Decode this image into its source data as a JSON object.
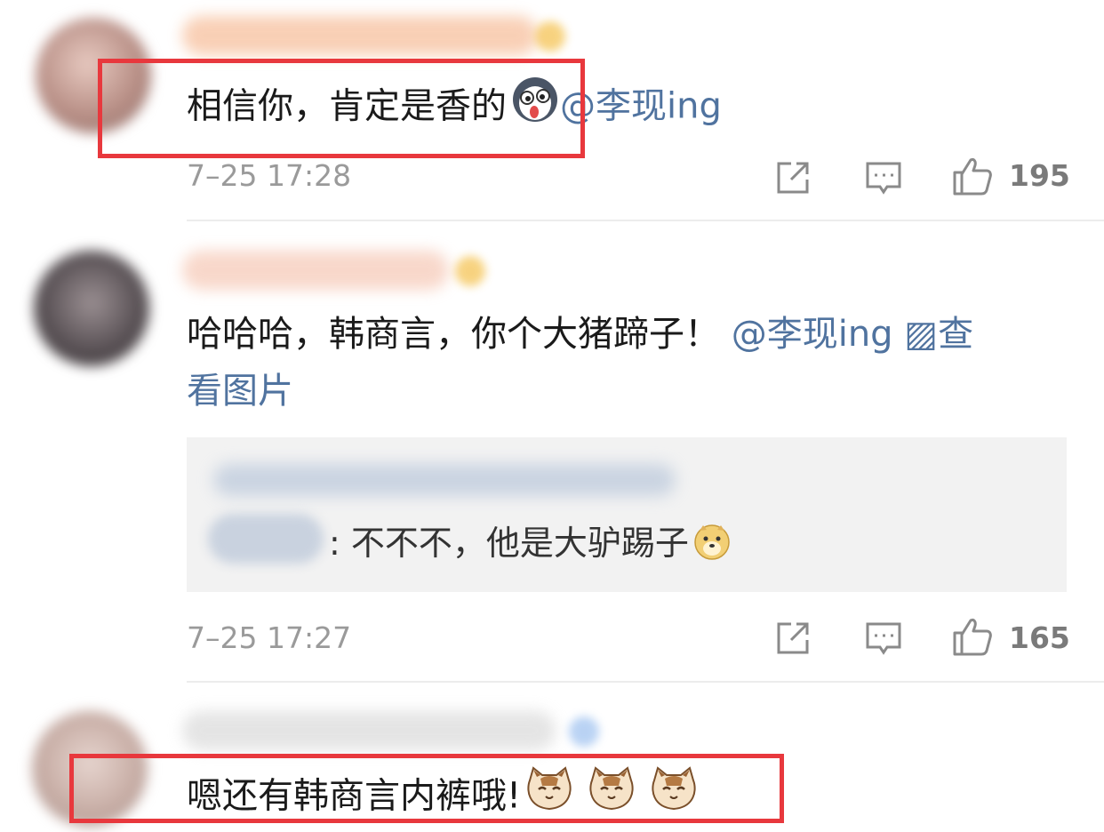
{
  "comments": [
    {
      "text": "相信你，肯定是香的",
      "mention": "@李现ing",
      "time": "7–25 17:28",
      "likes": "195"
    },
    {
      "text": "哈哈哈，韩商言，你个大猪蹄子！",
      "mention": "@李现ing",
      "link_icon": "▨",
      "link_text_1": "查",
      "link_text_2": "看图片",
      "reply": {
        "sep": ":",
        "text": "不不不，他是大驴踢子"
      },
      "time": "7–25 17:27",
      "likes": "165"
    },
    {
      "text": "嗯还有韩商言内裤哦!"
    }
  ],
  "icons": {
    "share": "share-icon",
    "comment": "comment-icon",
    "like": "thumbs-up-icon"
  },
  "colors": {
    "mention": "#50739f",
    "highlight_box": "#e8383d",
    "timestamp": "#9a9a9a"
  }
}
